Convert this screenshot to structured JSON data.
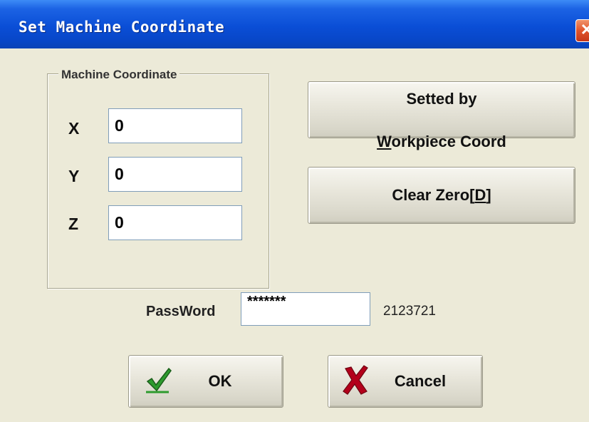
{
  "window": {
    "title": "Set Machine Coordinate",
    "close_label": "✕"
  },
  "group": {
    "legend": "Machine Coordinate",
    "axes": [
      {
        "label": "X",
        "value": "0"
      },
      {
        "label": "Y",
        "value": "0"
      },
      {
        "label": "Z",
        "value": "0"
      }
    ]
  },
  "buttons": {
    "set_by_line1": "Setted by",
    "set_by_accel": "W",
    "set_by_rest": "orkpiece Coord",
    "clear_prefix": "Clear Zero[",
    "clear_accel": "D",
    "clear_suffix": "]",
    "ok_label": "OK",
    "cancel_label": "Cancel"
  },
  "password": {
    "label": "PassWord",
    "value": "*******",
    "code": "2123721"
  },
  "icons": {
    "ok": "checkmark-icon",
    "cancel": "cross-icon",
    "close": "close-icon"
  },
  "colors": {
    "titlebar": "#0a4ed6",
    "window_bg": "#ecead8",
    "close_button": "#e0542c",
    "check_green": "#2e9b2e",
    "cross_red": "#b3001b"
  }
}
